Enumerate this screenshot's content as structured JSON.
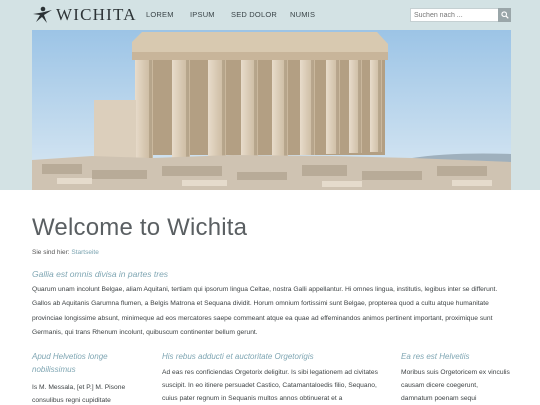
{
  "brand": {
    "name": "WICHITA"
  },
  "nav": {
    "items": [
      "LOREM",
      "IPSUM",
      "SED DOLOR",
      "NUMIS"
    ]
  },
  "search": {
    "placeholder": "Suchen nach ..."
  },
  "page": {
    "title": "Welcome to Wichita",
    "breadcrumb_label": "Sie sind hier:",
    "breadcrumb_link": "Startseite"
  },
  "lead": {
    "title": "Gallia est omnis divisa in partes tres",
    "text": "Quarum unam incolunt Belgae, aliam Aquitani, tertiam qui ipsorum lingua Celtae, nostra Galli appellantur. Hi omnes lingua, institutis, legibus inter se differunt. Gallos ab Aquitanis Garumna flumen, a Belgis Matrona et Sequana dividit. Horum omnium fortissimi sunt Belgae, propterea quod a cultu atque humanitate provinciae longissime absunt, minimeque ad eos mercatores saepe commeant atque ea quae ad effeminandos animos pertinent important, proximique sunt Germanis, qui trans Rhenum incolunt, quibuscum continenter bellum gerunt."
  },
  "columns": [
    {
      "title": "Apud Helvetios longe nobilissimus",
      "text": "Is M. Messala, [et P.] M. Pisone consulibus regni cupiditate"
    },
    {
      "title": "His rebus adducti et auctoritate Orgetorigis",
      "text": "Ad eas res conficiendas Orgetorix deligitur. Is sibi legationem ad civitates suscipit. In eo itinere persuadet Castico, Catamantaloedis filio, Sequano, cuius pater regnum in Sequanis multos annos obtinuerat et a"
    },
    {
      "title": "Ea res est Helvetiis",
      "text": "Moribus suis Orgetoricem ex vinculis causam dicere coegerunt, damnatum poenam sequi"
    }
  ],
  "colors": {
    "header_bg": "#d3e2e4",
    "accent": "#7fa6b3",
    "link": "#7aa3b0",
    "search_button": "#9aa6a9"
  },
  "icons": {
    "logo": "running-figure-icon",
    "search": "search-icon"
  }
}
